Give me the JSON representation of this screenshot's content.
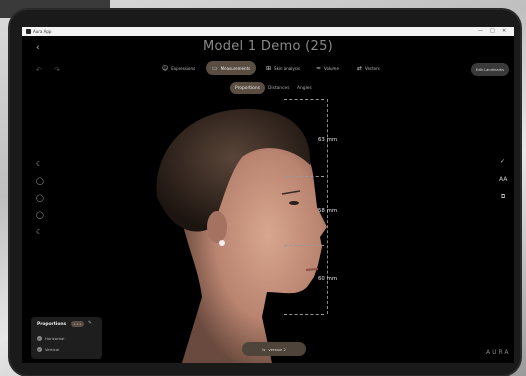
{
  "window": {
    "app_name": "Aura App",
    "controls": [
      "—",
      "□",
      "✕"
    ]
  },
  "header": {
    "back_icon": "chevron-left-icon",
    "title": "Model 1 Demo (25)"
  },
  "tabs": [
    {
      "label": "Expressions",
      "icon": "smile-icon",
      "active": false
    },
    {
      "label": "Measurements",
      "icon": "ruler-icon",
      "active": true
    },
    {
      "label": "Skin analysis",
      "icon": "grid-icon",
      "active": false
    },
    {
      "label": "Volume",
      "icon": "volume-icon",
      "active": false
    },
    {
      "label": "Vectors",
      "icon": "vector-icon",
      "active": false
    }
  ],
  "edit_button": {
    "label": "Edit Landmarks"
  },
  "subtabs": [
    {
      "label": "Proportions",
      "active": true
    },
    {
      "label": "Distances",
      "active": false
    },
    {
      "label": "Angles",
      "active": false
    }
  ],
  "measurements": [
    "63 mm",
    "58 mm",
    "60 mm"
  ],
  "proportions_panel": {
    "title": "Proportions",
    "pill": "• • •",
    "rows": [
      {
        "label": "Horizontal",
        "checked": true
      },
      {
        "label": "Vertical",
        "checked": true
      }
    ]
  },
  "version_button": {
    "label": "version 2"
  },
  "brand": "AURA",
  "colors": {
    "accent": "#5a4e43",
    "background": "#000000"
  }
}
